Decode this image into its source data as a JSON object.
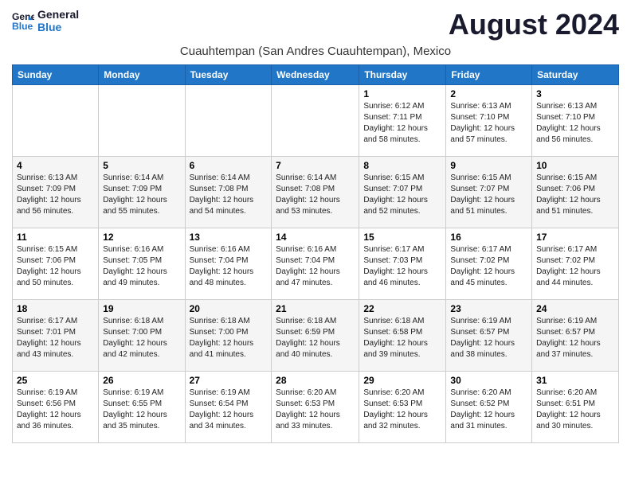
{
  "header": {
    "logo_line1": "General",
    "logo_line2": "Blue",
    "month_title": "August 2024",
    "location": "Cuauhtempan (San Andres Cuauhtempan), Mexico"
  },
  "days_of_week": [
    "Sunday",
    "Monday",
    "Tuesday",
    "Wednesday",
    "Thursday",
    "Friday",
    "Saturday"
  ],
  "weeks": [
    [
      {
        "num": "",
        "info": ""
      },
      {
        "num": "",
        "info": ""
      },
      {
        "num": "",
        "info": ""
      },
      {
        "num": "",
        "info": ""
      },
      {
        "num": "1",
        "info": "Sunrise: 6:12 AM\nSunset: 7:11 PM\nDaylight: 12 hours\nand 58 minutes."
      },
      {
        "num": "2",
        "info": "Sunrise: 6:13 AM\nSunset: 7:10 PM\nDaylight: 12 hours\nand 57 minutes."
      },
      {
        "num": "3",
        "info": "Sunrise: 6:13 AM\nSunset: 7:10 PM\nDaylight: 12 hours\nand 56 minutes."
      }
    ],
    [
      {
        "num": "4",
        "info": "Sunrise: 6:13 AM\nSunset: 7:09 PM\nDaylight: 12 hours\nand 56 minutes."
      },
      {
        "num": "5",
        "info": "Sunrise: 6:14 AM\nSunset: 7:09 PM\nDaylight: 12 hours\nand 55 minutes."
      },
      {
        "num": "6",
        "info": "Sunrise: 6:14 AM\nSunset: 7:08 PM\nDaylight: 12 hours\nand 54 minutes."
      },
      {
        "num": "7",
        "info": "Sunrise: 6:14 AM\nSunset: 7:08 PM\nDaylight: 12 hours\nand 53 minutes."
      },
      {
        "num": "8",
        "info": "Sunrise: 6:15 AM\nSunset: 7:07 PM\nDaylight: 12 hours\nand 52 minutes."
      },
      {
        "num": "9",
        "info": "Sunrise: 6:15 AM\nSunset: 7:07 PM\nDaylight: 12 hours\nand 51 minutes."
      },
      {
        "num": "10",
        "info": "Sunrise: 6:15 AM\nSunset: 7:06 PM\nDaylight: 12 hours\nand 51 minutes."
      }
    ],
    [
      {
        "num": "11",
        "info": "Sunrise: 6:15 AM\nSunset: 7:06 PM\nDaylight: 12 hours\nand 50 minutes."
      },
      {
        "num": "12",
        "info": "Sunrise: 6:16 AM\nSunset: 7:05 PM\nDaylight: 12 hours\nand 49 minutes."
      },
      {
        "num": "13",
        "info": "Sunrise: 6:16 AM\nSunset: 7:04 PM\nDaylight: 12 hours\nand 48 minutes."
      },
      {
        "num": "14",
        "info": "Sunrise: 6:16 AM\nSunset: 7:04 PM\nDaylight: 12 hours\nand 47 minutes."
      },
      {
        "num": "15",
        "info": "Sunrise: 6:17 AM\nSunset: 7:03 PM\nDaylight: 12 hours\nand 46 minutes."
      },
      {
        "num": "16",
        "info": "Sunrise: 6:17 AM\nSunset: 7:02 PM\nDaylight: 12 hours\nand 45 minutes."
      },
      {
        "num": "17",
        "info": "Sunrise: 6:17 AM\nSunset: 7:02 PM\nDaylight: 12 hours\nand 44 minutes."
      }
    ],
    [
      {
        "num": "18",
        "info": "Sunrise: 6:17 AM\nSunset: 7:01 PM\nDaylight: 12 hours\nand 43 minutes."
      },
      {
        "num": "19",
        "info": "Sunrise: 6:18 AM\nSunset: 7:00 PM\nDaylight: 12 hours\nand 42 minutes."
      },
      {
        "num": "20",
        "info": "Sunrise: 6:18 AM\nSunset: 7:00 PM\nDaylight: 12 hours\nand 41 minutes."
      },
      {
        "num": "21",
        "info": "Sunrise: 6:18 AM\nSunset: 6:59 PM\nDaylight: 12 hours\nand 40 minutes."
      },
      {
        "num": "22",
        "info": "Sunrise: 6:18 AM\nSunset: 6:58 PM\nDaylight: 12 hours\nand 39 minutes."
      },
      {
        "num": "23",
        "info": "Sunrise: 6:19 AM\nSunset: 6:57 PM\nDaylight: 12 hours\nand 38 minutes."
      },
      {
        "num": "24",
        "info": "Sunrise: 6:19 AM\nSunset: 6:57 PM\nDaylight: 12 hours\nand 37 minutes."
      }
    ],
    [
      {
        "num": "25",
        "info": "Sunrise: 6:19 AM\nSunset: 6:56 PM\nDaylight: 12 hours\nand 36 minutes."
      },
      {
        "num": "26",
        "info": "Sunrise: 6:19 AM\nSunset: 6:55 PM\nDaylight: 12 hours\nand 35 minutes."
      },
      {
        "num": "27",
        "info": "Sunrise: 6:19 AM\nSunset: 6:54 PM\nDaylight: 12 hours\nand 34 minutes."
      },
      {
        "num": "28",
        "info": "Sunrise: 6:20 AM\nSunset: 6:53 PM\nDaylight: 12 hours\nand 33 minutes."
      },
      {
        "num": "29",
        "info": "Sunrise: 6:20 AM\nSunset: 6:53 PM\nDaylight: 12 hours\nand 32 minutes."
      },
      {
        "num": "30",
        "info": "Sunrise: 6:20 AM\nSunset: 6:52 PM\nDaylight: 12 hours\nand 31 minutes."
      },
      {
        "num": "31",
        "info": "Sunrise: 6:20 AM\nSunset: 6:51 PM\nDaylight: 12 hours\nand 30 minutes."
      }
    ]
  ]
}
